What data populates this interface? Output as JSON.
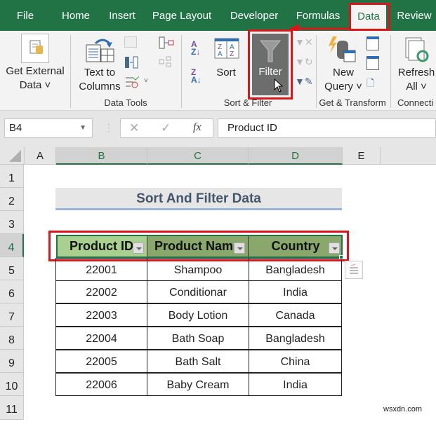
{
  "tabs": [
    {
      "label": "File",
      "active": false
    },
    {
      "label": "Home",
      "active": false
    },
    {
      "label": "Insert",
      "active": false
    },
    {
      "label": "Page Layout",
      "active": false
    },
    {
      "label": "Developer",
      "active": false
    },
    {
      "label": "Formulas",
      "active": false
    },
    {
      "label": "Data",
      "active": true
    },
    {
      "label": "Review",
      "active": false
    }
  ],
  "ribbon": {
    "get_external_data": {
      "line1": "Get External",
      "line2": "Data ˅"
    },
    "text_to_columns": {
      "line1": "Text to",
      "line2": "Columns"
    },
    "data_tools_label": "Data Tools",
    "sort_label": "Sort",
    "filter_label": "Filter",
    "sort_filter_label": "Sort & Filter",
    "new_query": {
      "line1": "New",
      "line2": "Query ˅"
    },
    "get_transform_label": "Get & Transform",
    "refresh_all": {
      "line1": "Refresh",
      "line2": "All ˅"
    },
    "connections_label": "Connecti"
  },
  "formula_bar": {
    "name_box": "B4",
    "formula": "Product ID",
    "fx": "fx",
    "cancel": "✕",
    "enter": "✓"
  },
  "columns": [
    "A",
    "B",
    "C",
    "D",
    "E"
  ],
  "rows": [
    "1",
    "2",
    "3",
    "4",
    "5",
    "6",
    "7",
    "8",
    "9",
    "10",
    "11"
  ],
  "sheet": {
    "title": "Sort And Filter Data",
    "headers": [
      "Product ID",
      "Product Nam",
      "Country"
    ],
    "data": [
      [
        "22001",
        "Shampoo",
        "Bangladesh"
      ],
      [
        "22002",
        "Conditionar",
        "India"
      ],
      [
        "22003",
        "Body Lotion",
        "Canada"
      ],
      [
        "22004",
        "Bath Soap",
        "Bangladesh"
      ],
      [
        "22005",
        "Bath Salt",
        "China"
      ],
      [
        "22006",
        "Baby Cream",
        "India"
      ]
    ]
  },
  "colors": {
    "excel_green": "#217346",
    "highlight_red": "#d9161a",
    "header_green_light": "#a9d08e",
    "header_green_dark": "#8aa86b"
  },
  "watermark": "wsxdn.com"
}
